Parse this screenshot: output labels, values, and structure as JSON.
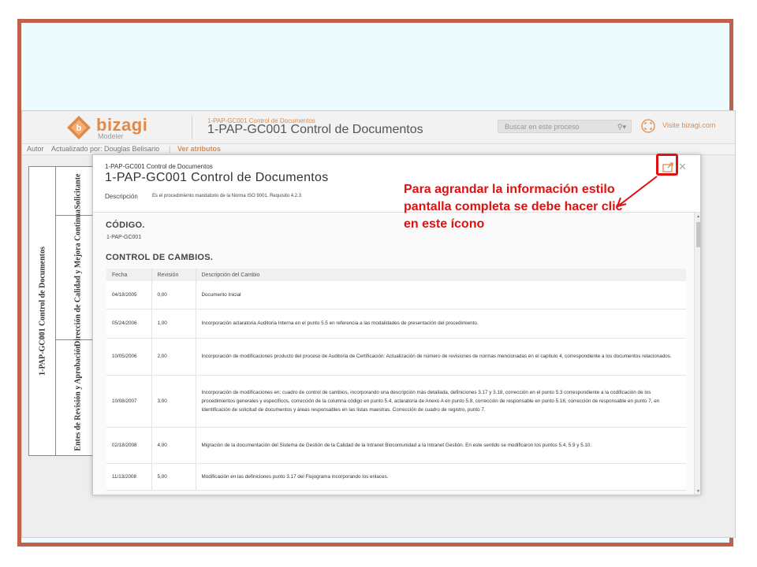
{
  "header": {
    "logo_word": "bizagi",
    "logo_sub": "Modeler",
    "crumb": "1-PAP-GC001 Control de Documentos",
    "title": "1-PAP-GC001 Control de Documentos",
    "search_placeholder": "Buscar en este proceso",
    "visit_link": "Visite bizagi.com"
  },
  "attributes_bar": {
    "author": "Autor",
    "updated_by": "Actualizado por: Douglas Belisario",
    "separator": "|",
    "view_attributes": "Ver atributos"
  },
  "diagram": {
    "pool": "1-PAP-GC001 Control de Documentos",
    "lanes": [
      "Solicitante",
      "Dirección de Calidad y Mejora Continua",
      "Entes de Revisión y Aprobación"
    ]
  },
  "modal": {
    "crumb": "1-PAP-GC001 Control de Documentos",
    "title": "1-PAP-GC001 Control de Documentos",
    "desc_label": "Descripción",
    "desc_text": "Es el procedimiento mandatorio de la Norma ISO 9001. Requisito 4.2.3",
    "code_section": {
      "title": "CÓDIGO.",
      "value": "1-PAP-GC001"
    },
    "changes_section": {
      "title": "CONTROL DE CAMBIOS.",
      "columns": [
        "Fecha",
        "Revisión",
        "Descripción del Cambio"
      ],
      "rows": [
        {
          "fecha": "04/18/2005",
          "revision": "0,00",
          "descripcion": "Documento Inicial"
        },
        {
          "fecha": "05/24/2006",
          "revision": "1,00",
          "descripcion": "Incorporación aclaratoria Auditoria Interna en el punto 5.5 en referencia a las modalidades de presentación del procedimiento."
        },
        {
          "fecha": "10/05/2006",
          "revision": "2,00",
          "descripcion": "Incorporación de modificaciones producto del proceso de Auditoria de Certificación: Actualización de número de revisiones de normas mencionadas en el capítulo 4, correspondiente a los documentos relacionados."
        },
        {
          "fecha": "10/08/2007",
          "revision": "3,00",
          "descripcion": "Incorporación de modificaciones en: cuadro de control de cambios, incorporando una descripción más detallada, definiciones 3.17 y 3.18, corrección en el punto 5.3 correspondiente a la codificación de los procedimientos generales y específicos, corrección de la columna código en punto 5.4, aclaratoria de Anexo A en punto 5.8, corrección de responsable en punto 5.16, corrección de responsable en punto 7, en Identificación de solicitud de documentos y áreas responsables en las listas maestras. Corrección de cuadro de registro, punto 7."
        },
        {
          "fecha": "02/18/2008",
          "revision": "4,00",
          "descripcion": "Migración de la documentación del Sistema de Gestión de la Calidad de la Intranet Biocomunidad a la Intranet Gestión. En este sentido se modificaron los puntos 5.4, 5.9 y 5.10."
        },
        {
          "fecha": "11/13/2008",
          "revision": "5,00",
          "descripcion": "Modificación en las definiciones punto 3.17 del Flujograma incorporando los enlaces."
        }
      ]
    }
  },
  "callout": {
    "text": "Para agrandar la información estilo pantalla completa se debe hacer clic en este ícono"
  },
  "colors": {
    "slide_border": "#c0614d",
    "slide_bg": "#edfafe",
    "accent": "#e08a4a",
    "annotation": "#e01010"
  },
  "icons": [
    "bizagi-logo-icon",
    "search-icon",
    "fullscreen-icon",
    "expand-icon",
    "close-icon"
  ]
}
